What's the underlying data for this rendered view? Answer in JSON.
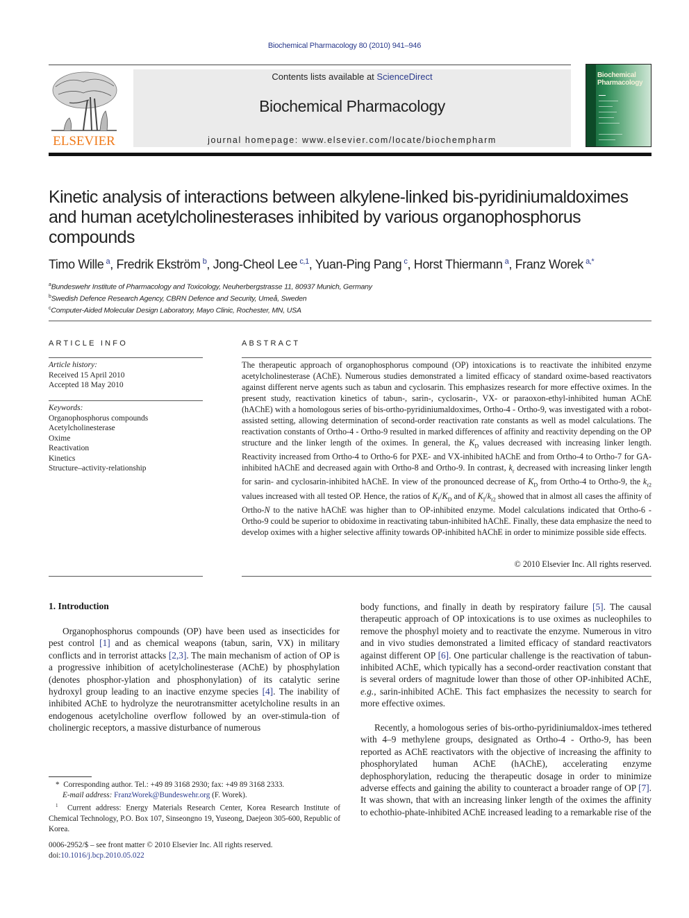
{
  "header": {
    "citation": "Biochemical Pharmacology 80 (2010) 941–946",
    "contents_prefix": "Contents lists available at ",
    "contents_link": "ScienceDirect",
    "journal_title": "Biochemical Pharmacology",
    "homepage": "journal homepage: www.elsevier.com/locate/biochempharm",
    "publisher_logo": "ELSEVIER",
    "cover_title_line1": "Biochemical",
    "cover_title_line2": "Pharmacology"
  },
  "article": {
    "title": "Kinetic analysis of interactions between alkylene-linked bis-pyridiniumaldoximes and human acetylcholinesterases inhibited by various organophosphorus compounds",
    "authors": [
      {
        "name": "Timo Wille",
        "sup": "a",
        "sep": ", "
      },
      {
        "name": "Fredrik Ekström",
        "sup": "b",
        "sep": ", "
      },
      {
        "name": "Jong-Cheol Lee",
        "sup": "c,1",
        "sep": ", "
      },
      {
        "name": "Yuan-Ping Pang",
        "sup": "c",
        "sep": ", "
      },
      {
        "name": "Horst Thiermann",
        "sup": "a",
        "sep": ", "
      },
      {
        "name": "Franz Worek",
        "sup": "a,*",
        "sep": ""
      }
    ],
    "affiliations": [
      {
        "sup": "a",
        "text": "Bundeswehr Institute of Pharmacology and Toxicology, Neuherbergstrasse 11, 80937 Munich, Germany"
      },
      {
        "sup": "b",
        "text": "Swedish Defence Research Agency, CBRN Defence and Security, Umeå, Sweden"
      },
      {
        "sup": "c",
        "text": "Computer-Aided Molecular Design Laboratory, Mayo Clinic, Rochester, MN, USA"
      }
    ]
  },
  "article_info": {
    "label": "ARTICLE INFO",
    "history_head": "Article history:",
    "received": "Received 15 April 2010",
    "accepted": "Accepted 18 May 2010",
    "keywords_head": "Keywords:",
    "keywords": [
      "Organophosphorus compounds",
      "Acetylcholinesterase",
      "Oxime",
      "Reactivation",
      "Kinetics",
      "Structure–activity-relationship"
    ]
  },
  "abstract": {
    "label": "ABSTRACT",
    "p1": "The therapeutic approach of organophosphorus compound (OP) intoxications is to reactivate the inhibited enzyme acetylcholinesterase (AChE). Numerous studies demonstrated a limited efficacy of standard oxime-based reactivators against different nerve agents such as tabun and cyclosarin. This emphasizes research for more effective oximes. In the present study, reactivation kinetics of tabun-, sarin-, cyclosarin-, VX- or paraoxon-ethyl-inhibited human AChE (hAChE) with a homologous series of bis-ortho-pyridiniumaldoximes, Ortho-4 - Ortho-9, was investigated with a robot-assisted setting, allowing determination of second-order reactivation rate constants as well as model calculations. The reactivation constants of Ortho-4 - Ortho-9 resulted in marked differences of affinity and reactivity depending on the OP structure and the linker length of the oximes. In general, the ",
    "kd1": "K",
    "kd1_sub": "D",
    "p2": " values decreased with increasing linker length. Reactivity increased from Ortho-4 to Ortho-6 for PXE- and VX-inhibited hAChE and from Ortho-4 to Ortho-7 for GA-inhibited hAChE and decreased again with Ortho-8 and Ortho-9. In contrast, ",
    "kr": "k",
    "kr_sub": "r",
    "p3": " decreased with increasing linker length for sarin- and cyclosarin-inhibited hAChE. In view of the pronounced decrease of ",
    "p4": " from Ortho-4 to Ortho-9, the ",
    "kr2_sub": "r2",
    "p5": " values increased with all tested OP. Hence, the ratios of ",
    "ki": "K",
    "ki_sub": "I",
    "p6": " and of ",
    "p7": " showed that in almost all cases the affinity of Ortho-",
    "n": "N",
    "p8": " to the native hAChE was higher than to OP-inhibited enzyme. Model calculations indicated that Ortho-6 - Ortho-9 could be superior to obidoxime in reactivating tabun-inhibited hAChE. Finally, these data emphasize the need to develop oximes with a higher selective affinity towards OP-inhibited hAChE in order to minimize possible side effects.",
    "copyright": "© 2010 Elsevier Inc. All rights reserved."
  },
  "introduction": {
    "heading": "1. Introduction",
    "left_col": [
      {
        "t": "Organophosphorus compounds (OP) have been used as insecticides for pest control "
      },
      {
        "ref": "[1]"
      },
      {
        "t": " and as chemical weapons (tabun, sarin, VX) in military conflicts and in terrorist attacks "
      },
      {
        "ref": "[2,3]"
      },
      {
        "t": ". The main mechanism of action of OP is a progressive inhibition of acetylcholinesterase (AChE) by phosphylation (denotes phosphor-ylation and phosphonylation) of its catalytic serine hydroxyl group leading to an inactive enzyme species "
      },
      {
        "ref": "[4]"
      },
      {
        "t": ". The inability of inhibited AChE to hydrolyze the neurotransmitter acetylcholine results in an endogenous acetylcholine overflow followed by an over-stimula-tion of cholinergic receptors, a massive disturbance of numerous"
      }
    ],
    "right_p1": [
      {
        "t": "body functions, and finally in death by respiratory failure "
      },
      {
        "ref": "[5]"
      },
      {
        "t": ". The causal therapeutic approach of OP intoxications is to use oximes as nucleophiles to remove the phosphyl moiety and to reactivate the enzyme. Numerous in vitro and in vivo studies demonstrated a limited efficacy of standard reactivators against different OP "
      },
      {
        "ref": "[6]"
      },
      {
        "t": ". One particular challenge is the reactivation of tabun-inhibited AChE, which typically has a second-order reactivation constant that is several orders of magnitude lower than those of other OP-inhibited AChE, "
      },
      {
        "i": "e.g."
      },
      {
        "t": ", sarin-inhibited AChE. This fact emphasizes the necessity to search for more effective oximes."
      }
    ],
    "right_p2": [
      {
        "t": "Recently, a homologous series of bis-ortho-pyridiniumaldox-imes tethered with 4–9 methylene groups, designated as Ortho-4 - Ortho-9, has been reported as AChE reactivators with the objective of increasing the affinity to phosphorylated human AChE (hAChE), accelerating enzyme dephosphorylation, reducing the therapeutic dosage in order to minimize adverse effects and gaining the ability to counteract a broader range of OP "
      },
      {
        "ref": "[7]"
      },
      {
        "t": ". It was shown, that with an increasing linker length of the oximes the affinity to echothio-phate-inhibited AChE increased leading to a remarkable rise of the"
      }
    ]
  },
  "footnotes": {
    "corr_mark": "*",
    "corr_text": "Corresponding author. Tel.: +49 89 3168 2930; fax: +49 89 3168 2333.",
    "email_label": "E-mail address: ",
    "email": "FranzWorek@Bundeswehr.org",
    "email_suffix": " (F. Worek).",
    "fn1_mark": "1",
    "fn1_text": "Current address: Energy Materials Research Center, Korea Research Institute of Chemical Technology, P.O. Box 107, Sinseongno 19, Yuseong, Daejeon 305-600, Republic of Korea.",
    "front_matter": "0006-2952/$ – see front matter © 2010 Elsevier Inc. All rights reserved.",
    "doi_label": "doi:",
    "doi": "10.1016/j.bcp.2010.05.022"
  },
  "colors": {
    "link": "#2a3a8c",
    "elsevier_orange": "#f07a1a",
    "masthead_bg": "#ebebeb",
    "cover_green": "#2b8a55"
  }
}
